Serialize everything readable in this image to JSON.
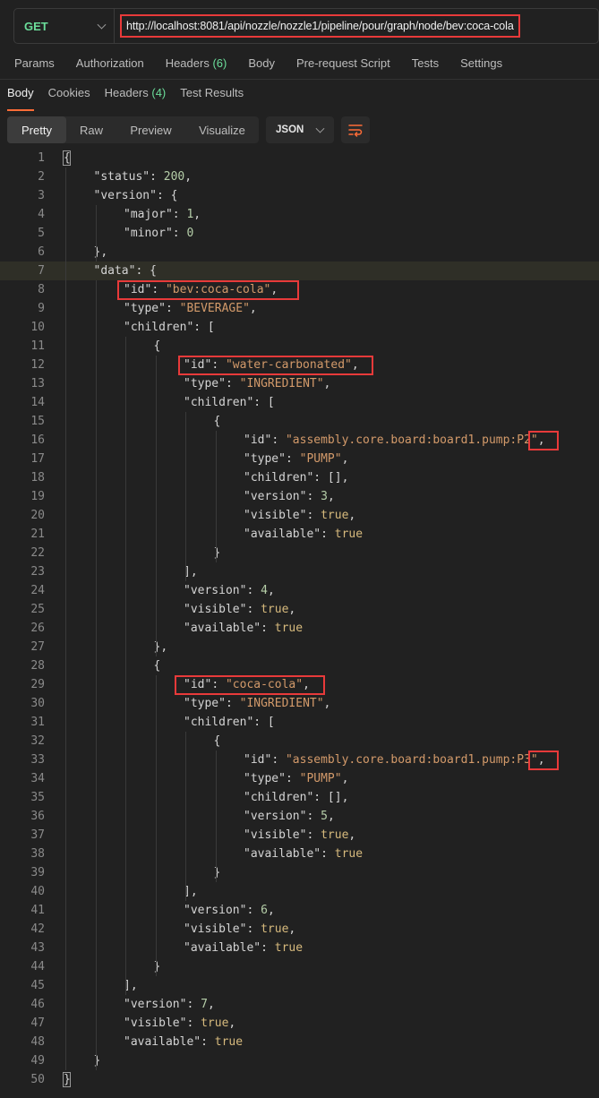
{
  "request": {
    "method": "GET",
    "url": "http://localhost:8081/api/nozzle/nozzle1/pipeline/pour/graph/node/bev:coca-cola"
  },
  "request_tabs": [
    {
      "label": "Params",
      "count": ""
    },
    {
      "label": "Authorization",
      "count": ""
    },
    {
      "label": "Headers",
      "count": "(6)"
    },
    {
      "label": "Body",
      "count": ""
    },
    {
      "label": "Pre-request Script",
      "count": ""
    },
    {
      "label": "Tests",
      "count": ""
    },
    {
      "label": "Settings",
      "count": ""
    }
  ],
  "response_tabs": [
    {
      "label": "Body",
      "count": "",
      "active": true
    },
    {
      "label": "Cookies",
      "count": "",
      "active": false
    },
    {
      "label": "Headers",
      "count": "(4)",
      "active": false
    },
    {
      "label": "Test Results",
      "count": "",
      "active": false
    }
  ],
  "view_modes": [
    "Pretty",
    "Raw",
    "Preview",
    "Visualize"
  ],
  "active_view": "Pretty",
  "format": "JSON",
  "colors": {
    "accent": "#ff6c37",
    "method_get": "#6bdd9a",
    "highlight_box": "#e83a3a",
    "string": "#d39a6a",
    "number": "#b5cea8",
    "boolean": "#d7ba7d"
  },
  "icons": {
    "method_dropdown": "chevron-down-icon",
    "format_dropdown": "chevron-down-icon",
    "wrap": "wrap-lines-icon"
  },
  "highlighted_line": 7,
  "code_lines": [
    {
      "n": "1",
      "i": 0,
      "t": [
        [
          "pun",
          "{"
        ]
      ]
    },
    {
      "n": "2",
      "i": 1,
      "t": [
        [
          "key",
          "\"status\""
        ],
        [
          "pun",
          ": "
        ],
        [
          "num",
          "200"
        ],
        [
          "pun",
          ","
        ]
      ]
    },
    {
      "n": "3",
      "i": 1,
      "t": [
        [
          "key",
          "\"version\""
        ],
        [
          "pun",
          ": {"
        ]
      ]
    },
    {
      "n": "4",
      "i": 2,
      "t": [
        [
          "key",
          "\"major\""
        ],
        [
          "pun",
          ": "
        ],
        [
          "num",
          "1"
        ],
        [
          "pun",
          ","
        ]
      ]
    },
    {
      "n": "5",
      "i": 2,
      "t": [
        [
          "key",
          "\"minor\""
        ],
        [
          "pun",
          ": "
        ],
        [
          "num",
          "0"
        ]
      ]
    },
    {
      "n": "6",
      "i": 1,
      "t": [
        [
          "pun",
          "},"
        ]
      ]
    },
    {
      "n": "7",
      "i": 1,
      "t": [
        [
          "key",
          "\"data\""
        ],
        [
          "pun",
          ": {"
        ]
      ]
    },
    {
      "n": "8",
      "i": 2,
      "t": [
        [
          "key",
          "\"id\""
        ],
        [
          "pun",
          ": "
        ],
        [
          "str",
          "\"bev:coca-cola\""
        ],
        [
          "pun",
          ","
        ]
      ]
    },
    {
      "n": "9",
      "i": 2,
      "t": [
        [
          "key",
          "\"type\""
        ],
        [
          "pun",
          ": "
        ],
        [
          "str",
          "\"BEVERAGE\""
        ],
        [
          "pun",
          ","
        ]
      ]
    },
    {
      "n": "10",
      "i": 2,
      "t": [
        [
          "key",
          "\"children\""
        ],
        [
          "pun",
          ": ["
        ]
      ]
    },
    {
      "n": "11",
      "i": 3,
      "t": [
        [
          "pun",
          "{"
        ]
      ]
    },
    {
      "n": "12",
      "i": 4,
      "t": [
        [
          "key",
          "\"id\""
        ],
        [
          "pun",
          ": "
        ],
        [
          "str",
          "\"water-carbonated\""
        ],
        [
          "pun",
          ","
        ]
      ]
    },
    {
      "n": "13",
      "i": 4,
      "t": [
        [
          "key",
          "\"type\""
        ],
        [
          "pun",
          ": "
        ],
        [
          "str",
          "\"INGREDIENT\""
        ],
        [
          "pun",
          ","
        ]
      ]
    },
    {
      "n": "14",
      "i": 4,
      "t": [
        [
          "key",
          "\"children\""
        ],
        [
          "pun",
          ": ["
        ]
      ]
    },
    {
      "n": "15",
      "i": 5,
      "t": [
        [
          "pun",
          "{"
        ]
      ]
    },
    {
      "n": "16",
      "i": 6,
      "t": [
        [
          "key",
          "\"id\""
        ],
        [
          "pun",
          ": "
        ],
        [
          "str",
          "\"assembly.core.board:board1.pump:P2\""
        ],
        [
          "pun",
          ","
        ]
      ]
    },
    {
      "n": "17",
      "i": 6,
      "t": [
        [
          "key",
          "\"type\""
        ],
        [
          "pun",
          ": "
        ],
        [
          "str",
          "\"PUMP\""
        ],
        [
          "pun",
          ","
        ]
      ]
    },
    {
      "n": "18",
      "i": 6,
      "t": [
        [
          "key",
          "\"children\""
        ],
        [
          "pun",
          ": [],"
        ]
      ]
    },
    {
      "n": "19",
      "i": 6,
      "t": [
        [
          "key",
          "\"version\""
        ],
        [
          "pun",
          ": "
        ],
        [
          "num",
          "3"
        ],
        [
          "pun",
          ","
        ]
      ]
    },
    {
      "n": "20",
      "i": 6,
      "t": [
        [
          "key",
          "\"visible\""
        ],
        [
          "pun",
          ": "
        ],
        [
          "bool",
          "true"
        ],
        [
          "pun",
          ","
        ]
      ]
    },
    {
      "n": "21",
      "i": 6,
      "t": [
        [
          "key",
          "\"available\""
        ],
        [
          "pun",
          ": "
        ],
        [
          "bool",
          "true"
        ]
      ]
    },
    {
      "n": "22",
      "i": 5,
      "t": [
        [
          "pun",
          "}"
        ]
      ]
    },
    {
      "n": "23",
      "i": 4,
      "t": [
        [
          "pun",
          "],"
        ]
      ]
    },
    {
      "n": "24",
      "i": 4,
      "t": [
        [
          "key",
          "\"version\""
        ],
        [
          "pun",
          ": "
        ],
        [
          "num",
          "4"
        ],
        [
          "pun",
          ","
        ]
      ]
    },
    {
      "n": "25",
      "i": 4,
      "t": [
        [
          "key",
          "\"visible\""
        ],
        [
          "pun",
          ": "
        ],
        [
          "bool",
          "true"
        ],
        [
          "pun",
          ","
        ]
      ]
    },
    {
      "n": "26",
      "i": 4,
      "t": [
        [
          "key",
          "\"available\""
        ],
        [
          "pun",
          ": "
        ],
        [
          "bool",
          "true"
        ]
      ]
    },
    {
      "n": "27",
      "i": 3,
      "t": [
        [
          "pun",
          "},"
        ]
      ]
    },
    {
      "n": "28",
      "i": 3,
      "t": [
        [
          "pun",
          "{"
        ]
      ]
    },
    {
      "n": "29",
      "i": 4,
      "t": [
        [
          "key",
          "\"id\""
        ],
        [
          "pun",
          ": "
        ],
        [
          "str",
          "\"coca-cola\""
        ],
        [
          "pun",
          ","
        ]
      ]
    },
    {
      "n": "30",
      "i": 4,
      "t": [
        [
          "key",
          "\"type\""
        ],
        [
          "pun",
          ": "
        ],
        [
          "str",
          "\"INGREDIENT\""
        ],
        [
          "pun",
          ","
        ]
      ]
    },
    {
      "n": "31",
      "i": 4,
      "t": [
        [
          "key",
          "\"children\""
        ],
        [
          "pun",
          ": ["
        ]
      ]
    },
    {
      "n": "32",
      "i": 5,
      "t": [
        [
          "pun",
          "{"
        ]
      ]
    },
    {
      "n": "33",
      "i": 6,
      "t": [
        [
          "key",
          "\"id\""
        ],
        [
          "pun",
          ": "
        ],
        [
          "str",
          "\"assembly.core.board:board1.pump:P3\""
        ],
        [
          "pun",
          ","
        ]
      ]
    },
    {
      "n": "34",
      "i": 6,
      "t": [
        [
          "key",
          "\"type\""
        ],
        [
          "pun",
          ": "
        ],
        [
          "str",
          "\"PUMP\""
        ],
        [
          "pun",
          ","
        ]
      ]
    },
    {
      "n": "35",
      "i": 6,
      "t": [
        [
          "key",
          "\"children\""
        ],
        [
          "pun",
          ": [],"
        ]
      ]
    },
    {
      "n": "36",
      "i": 6,
      "t": [
        [
          "key",
          "\"version\""
        ],
        [
          "pun",
          ": "
        ],
        [
          "num",
          "5"
        ],
        [
          "pun",
          ","
        ]
      ]
    },
    {
      "n": "37",
      "i": 6,
      "t": [
        [
          "key",
          "\"visible\""
        ],
        [
          "pun",
          ": "
        ],
        [
          "bool",
          "true"
        ],
        [
          "pun",
          ","
        ]
      ]
    },
    {
      "n": "38",
      "i": 6,
      "t": [
        [
          "key",
          "\"available\""
        ],
        [
          "pun",
          ": "
        ],
        [
          "bool",
          "true"
        ]
      ]
    },
    {
      "n": "39",
      "i": 5,
      "t": [
        [
          "pun",
          "}"
        ]
      ]
    },
    {
      "n": "40",
      "i": 4,
      "t": [
        [
          "pun",
          "],"
        ]
      ]
    },
    {
      "n": "41",
      "i": 4,
      "t": [
        [
          "key",
          "\"version\""
        ],
        [
          "pun",
          ": "
        ],
        [
          "num",
          "6"
        ],
        [
          "pun",
          ","
        ]
      ]
    },
    {
      "n": "42",
      "i": 4,
      "t": [
        [
          "key",
          "\"visible\""
        ],
        [
          "pun",
          ": "
        ],
        [
          "bool",
          "true"
        ],
        [
          "pun",
          ","
        ]
      ]
    },
    {
      "n": "43",
      "i": 4,
      "t": [
        [
          "key",
          "\"available\""
        ],
        [
          "pun",
          ": "
        ],
        [
          "bool",
          "true"
        ]
      ]
    },
    {
      "n": "44",
      "i": 3,
      "t": [
        [
          "pun",
          "}"
        ]
      ]
    },
    {
      "n": "45",
      "i": 2,
      "t": [
        [
          "pun",
          "],"
        ]
      ]
    },
    {
      "n": "46",
      "i": 2,
      "t": [
        [
          "key",
          "\"version\""
        ],
        [
          "pun",
          ": "
        ],
        [
          "num",
          "7"
        ],
        [
          "pun",
          ","
        ]
      ]
    },
    {
      "n": "47",
      "i": 2,
      "t": [
        [
          "key",
          "\"visible\""
        ],
        [
          "pun",
          ": "
        ],
        [
          "bool",
          "true"
        ],
        [
          "pun",
          ","
        ]
      ]
    },
    {
      "n": "48",
      "i": 2,
      "t": [
        [
          "key",
          "\"available\""
        ],
        [
          "pun",
          ": "
        ],
        [
          "bool",
          "true"
        ]
      ]
    },
    {
      "n": "49",
      "i": 1,
      "t": [
        [
          "pun",
          "}"
        ]
      ]
    },
    {
      "n": "50",
      "i": 0,
      "t": [
        [
          "pun",
          "}"
        ]
      ]
    }
  ]
}
